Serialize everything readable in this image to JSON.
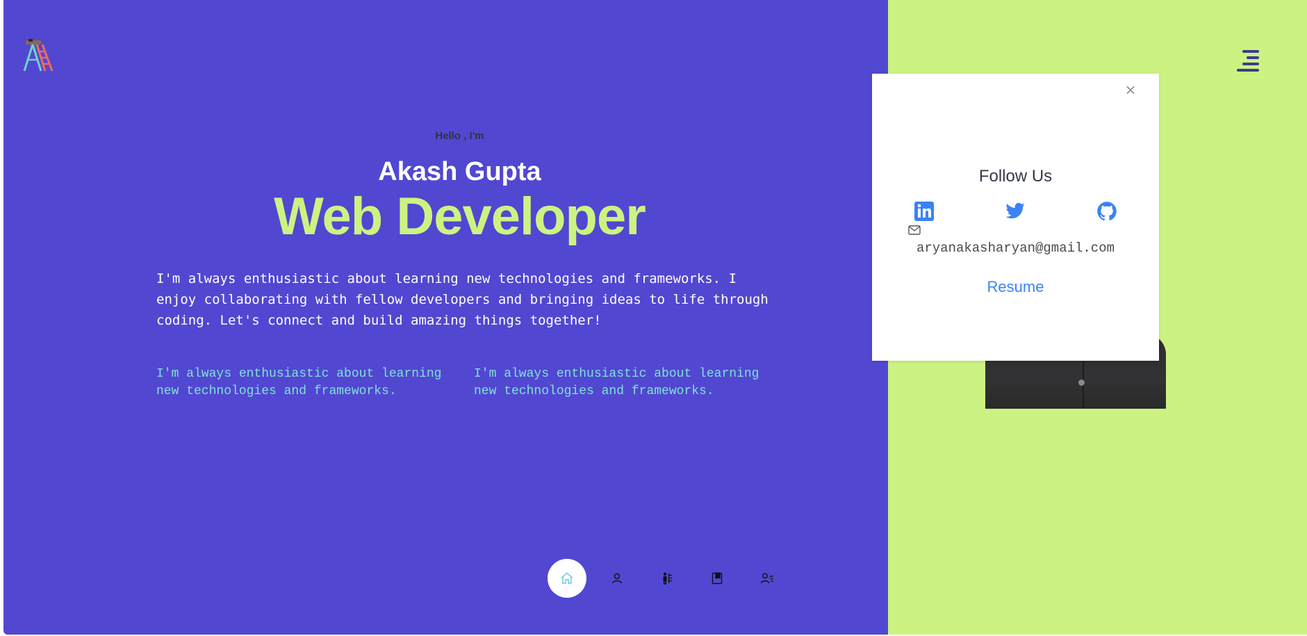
{
  "hero": {
    "greeting": "Hello , I'm",
    "name": "Akash Gupta",
    "role": "Web Developer",
    "intro": "I'm always enthusiastic about learning new technologies and frameworks. I enjoy collaborating with fellow developers and bringing ideas to life through coding. Let's connect and build amazing things together!",
    "features": [
      "I'm always enthusiastic about learning new technologies and frameworks.",
      "I'm always enthusiastic about learning new technologies and frameworks."
    ]
  },
  "bottom_nav": {
    "items": [
      {
        "icon": "home-icon",
        "active": true
      },
      {
        "icon": "user-icon",
        "active": false
      },
      {
        "icon": "skills-icon",
        "active": false
      },
      {
        "icon": "book-icon",
        "active": false
      },
      {
        "icon": "contact-list-icon",
        "active": false
      }
    ]
  },
  "modal": {
    "close_label": "×",
    "title": "Follow Us",
    "socials": [
      "linkedin-icon",
      "twitter-icon",
      "github-icon"
    ],
    "email": "aryanakasharyan@gmail.com",
    "resume_label": "Resume"
  },
  "colors": {
    "primary": "#5247d1",
    "accent": "#ccf381",
    "link": "#3b82f6",
    "feature_text": "#7fe3d6"
  }
}
